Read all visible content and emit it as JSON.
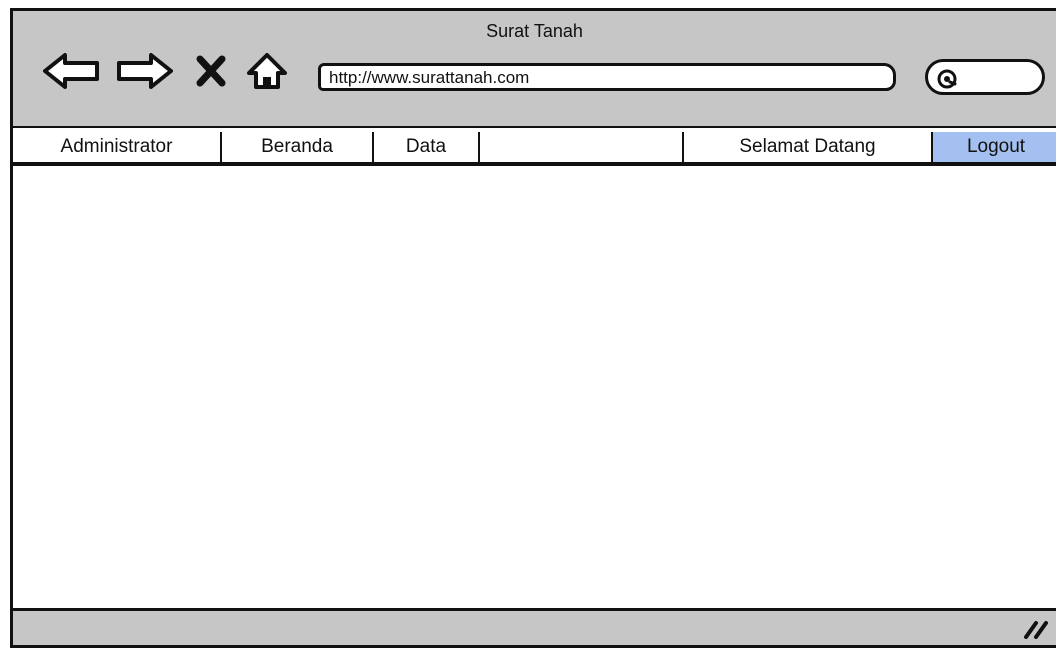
{
  "window": {
    "title": "Surat Tanah",
    "url": "http://www.surattanah.com"
  },
  "toolbar": {
    "icons": [
      "back-arrow-icon",
      "forward-arrow-icon",
      "close-icon",
      "home-icon",
      "search-icon",
      "resize-grip-icon"
    ]
  },
  "menu": {
    "items": [
      {
        "label": "Administrator"
      },
      {
        "label": "Beranda"
      },
      {
        "label": "Data"
      },
      {
        "label": ""
      },
      {
        "label": "Selamat Datang"
      },
      {
        "label": "Logout"
      }
    ]
  },
  "colors": {
    "chrome": "#c6c6c6",
    "active_menu": "#a3c0f0",
    "stroke": "#111111"
  }
}
